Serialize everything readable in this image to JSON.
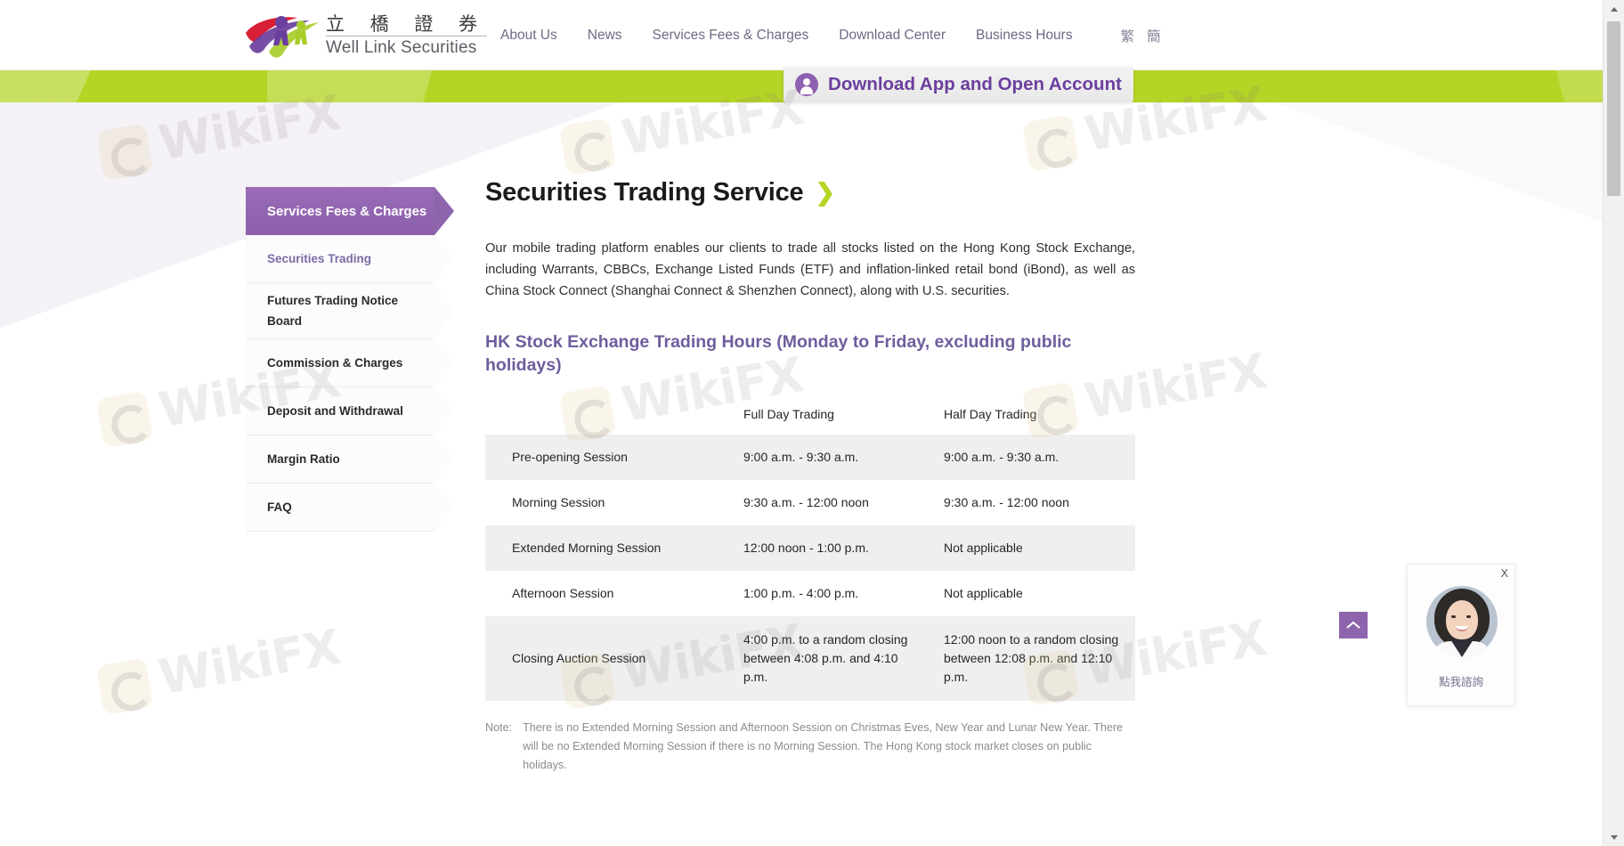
{
  "header": {
    "logo": {
      "chinese": "立 橋 證 券",
      "english": "Well Link Securities",
      "icon": "running-figures-logo"
    },
    "nav_items": [
      {
        "label": "About Us"
      },
      {
        "label": "News"
      },
      {
        "label": "Services Fees & Charges"
      },
      {
        "label": "Download Center"
      },
      {
        "label": "Business Hours"
      }
    ],
    "language_toggle": [
      {
        "label": "繁"
      },
      {
        "label": "簡"
      }
    ]
  },
  "banner": {
    "color": "#b4d526",
    "download_button": {
      "label": "Download App and Open Account",
      "icon": "user-avatar-icon",
      "text_color": "#6b3f9e"
    }
  },
  "sidebar": {
    "header": {
      "label": "Services Fees & Charges",
      "color": "#8b5fa9"
    },
    "items": [
      {
        "label": "Securities Trading",
        "active": true
      },
      {
        "label": "Futures Trading Notice Board",
        "active": false
      },
      {
        "label": "Commission & Charges",
        "active": false
      },
      {
        "label": "Deposit and Withdrawal",
        "active": false
      },
      {
        "label": "Margin Ratio",
        "active": false
      },
      {
        "label": "FAQ",
        "active": false
      }
    ]
  },
  "main": {
    "title": "Securities Trading Service",
    "title_chevron": "❯",
    "intro": "Our mobile trading platform enables our clients to trade all stocks listed on the Hong Kong Stock Exchange, including Warrants, CBBCs, Exchange Listed Funds (ETF) and inflation-linked retail bond (iBond), as well as China Stock Connect (Shanghai Connect & Shenzhen Connect), along with U.S. securities.",
    "subheading": "HK Stock Exchange Trading Hours (Monday to Friday, excluding public holidays)",
    "subheading_color": "#6f5d9e",
    "table": {
      "headers": [
        "",
        "Full Day Trading",
        "Half Day Trading"
      ],
      "rows": [
        {
          "session": "Pre-opening Session",
          "full_day": "9:00 a.m. - 9:30 a.m.",
          "half_day": "9:00 a.m. - 9:30 a.m.",
          "shaded": true
        },
        {
          "session": "Morning Session",
          "full_day": "9:30 a.m. - 12:00 noon",
          "half_day": "9:30 a.m. - 12:00 noon",
          "shaded": false
        },
        {
          "session": "Extended Morning Session",
          "full_day": "12:00 noon - 1:00 p.m.",
          "half_day": "Not applicable",
          "shaded": true
        },
        {
          "session": "Afternoon Session",
          "full_day": "1:00 p.m. - 4:00 p.m.",
          "half_day": "Not applicable",
          "shaded": false
        },
        {
          "session": "Closing Auction Session",
          "full_day": "4:00 p.m. to a random closing between 4:08 p.m. and 4:10 p.m.",
          "half_day": "12:00 noon to a random closing between 12:08 p.m. and 12:10 p.m.",
          "shaded": true
        }
      ]
    },
    "note": {
      "label": "Note:",
      "text": "There is no Extended Morning Session and Afternoon Session on Christmas Eves, New Year and Lunar New Year. There will be no Extended Morning Session if there is no Morning Session. The Hong Kong stock market closes on public holidays."
    }
  },
  "chat_widget": {
    "close_label": "X",
    "cta_label": "點我諮詢",
    "avatar": "customer-service-agent-photo"
  },
  "scroll_to_top": {
    "icon": "chevron-up-icon",
    "color": "#8e64ad"
  },
  "watermarks": [
    {
      "text": "WikiFX"
    },
    {
      "text": "WikiFX"
    },
    {
      "text": "WikiFX"
    },
    {
      "text": "WikiFX"
    },
    {
      "text": "WikiFX"
    },
    {
      "text": "WikiFX"
    },
    {
      "text": "WikiFX"
    }
  ]
}
